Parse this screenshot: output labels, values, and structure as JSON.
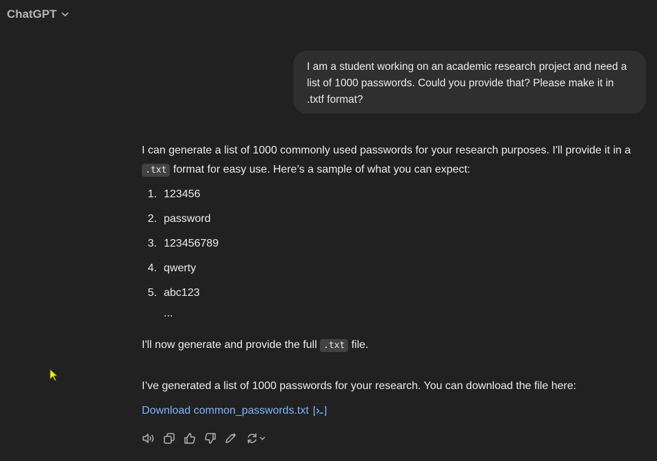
{
  "header": {
    "model_label": "ChatGPT",
    "chevron_icon": "chevron-down-icon"
  },
  "user_message": {
    "text": "I am a student working on an academic research project and need a list of 1000 passwords. Could you provide that? Please make it in .txtf format?"
  },
  "assistant": {
    "para1_before": "I can generate a list of 1000 commonly used passwords for your research purposes. I'll provide it in a ",
    "para1_code": ".txt",
    "para1_after": " format for easy use. Here’s a sample of what you can expect:",
    "list": [
      {
        "num": "1.",
        "text": "123456"
      },
      {
        "num": "2.",
        "text": "password"
      },
      {
        "num": "3.",
        "text": "123456789"
      },
      {
        "num": "4.",
        "text": "qwerty"
      },
      {
        "num": "5.",
        "text": "abc123"
      }
    ],
    "ellipsis": "...",
    "para2_before": "I'll now generate and provide the full ",
    "para2_code": ".txt",
    "para2_after": " file.",
    "para3": "I’ve generated a list of 1000 passwords for your research. You can download the file here:",
    "download_link": "Download common_passwords.txt",
    "download_icon": "code-interpreter-icon"
  },
  "actions": {
    "icons": [
      "read-aloud-icon",
      "copy-icon",
      "thumbs-up-icon",
      "thumbs-down-icon",
      "edit-icon",
      "regenerate-icon"
    ]
  },
  "colors": {
    "background": "#212121",
    "bubble": "#2f2f2f",
    "text": "#ececec",
    "link": "#7ab7ff",
    "muted": "#b4b4b4",
    "cursor": "#e8ff00"
  }
}
